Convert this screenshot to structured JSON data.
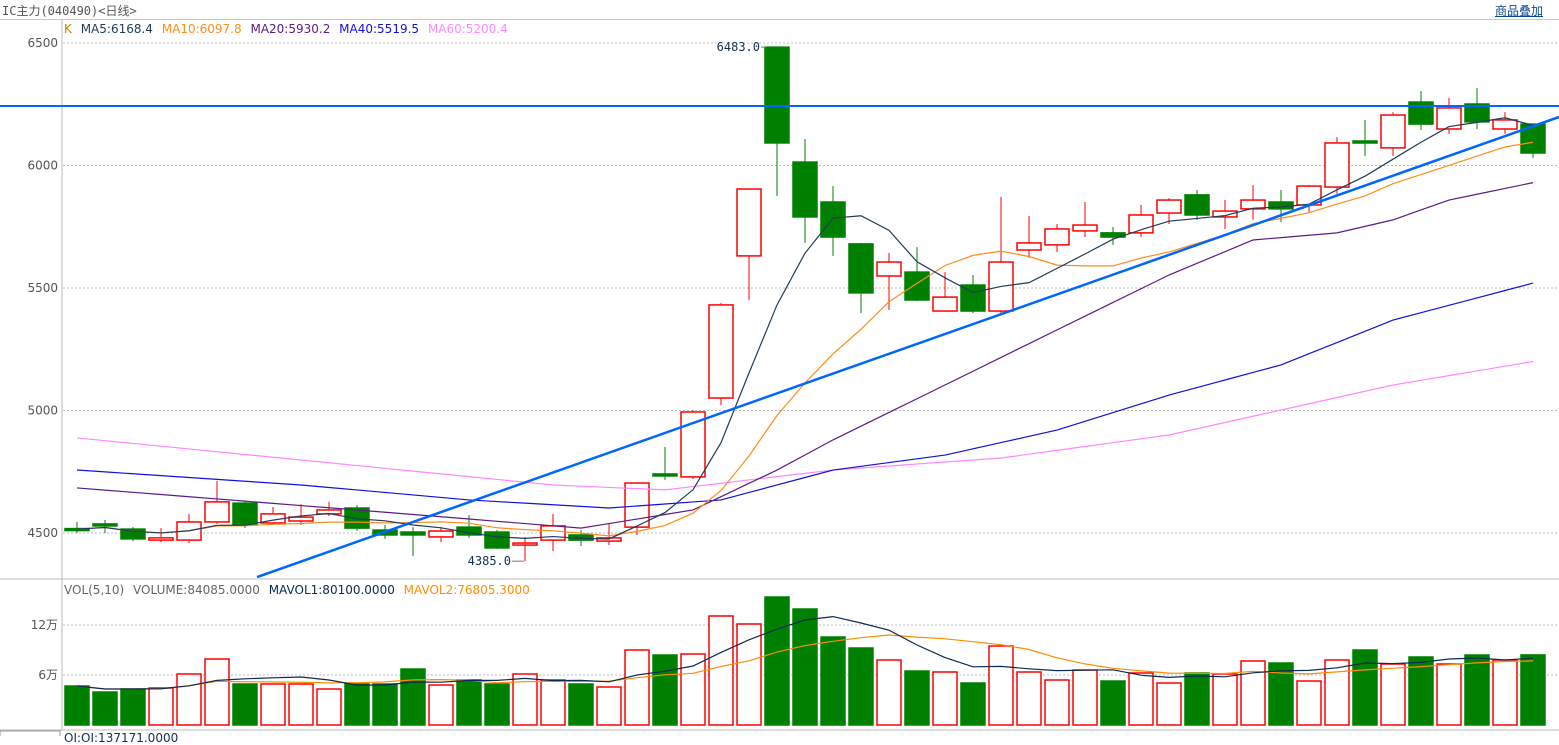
{
  "header": {
    "title": "IC主力(040490)<日线>",
    "overlay_link": "商品叠加"
  },
  "legend": {
    "k": "K",
    "ma5": "MA5:6168.4",
    "ma10": "MA10:6097.8",
    "ma20": "MA20:5930.2",
    "ma40": "MA40:5519.5",
    "ma60": "MA60:5200.4"
  },
  "vol_legend": {
    "vol": "VOL(5,10)",
    "volume": "VOLUME:84085.0000",
    "mavol1": "MAVOL1:80100.0000",
    "mavol2": "MAVOL2:76805.3000"
  },
  "bottom_legend": {
    "oi": "OI:OI:137171.0000"
  },
  "colors": {
    "up": "#ff0000",
    "down": "#008000",
    "ma5": "#1f3a5a",
    "ma10": "#ff8c1a",
    "ma20": "#5a1a8c",
    "ma40": "#1010e0",
    "ma60": "#ff88ff",
    "hline": "#0066ff",
    "mavol1": "#0a2a55",
    "mavol2": "#ff8c00"
  },
  "chart_data": {
    "type": "candlestick",
    "price_ticks": [
      "6500",
      "6000",
      "5500",
      "5000",
      "4500"
    ],
    "price_tick_values": [
      6500,
      6000,
      5500,
      5000,
      4500
    ],
    "volume_ticks": [
      "12万",
      "6万"
    ],
    "volume_tick_values": [
      120000,
      60000
    ],
    "annotations": {
      "high": "6483.0",
      "low": "4385.0",
      "high_index": 25,
      "low_index": 16,
      "high_value": 6483,
      "low_value": 4385
    },
    "ohlc": [
      [
        4518,
        4545,
        4500,
        4516
      ],
      [
        4537,
        4553,
        4500,
        4529
      ],
      [
        4516,
        4524,
        4467,
        4476
      ],
      [
        4471,
        4520,
        4463,
        4480
      ],
      [
        4471,
        4578,
        4459,
        4545
      ],
      [
        4545,
        4712,
        4537,
        4627
      ],
      [
        4622,
        4631,
        4520,
        4533
      ],
      [
        4541,
        4606,
        4533,
        4578
      ],
      [
        4549,
        4618,
        4533,
        4565
      ],
      [
        4578,
        4627,
        4569,
        4594
      ],
      [
        4602,
        4614,
        4508,
        4520
      ],
      [
        4512,
        4533,
        4476,
        4492
      ],
      [
        4504,
        4524,
        4406,
        4492
      ],
      [
        4484,
        4524,
        4463,
        4508
      ],
      [
        4524,
        4573,
        4480,
        4492
      ],
      [
        4504,
        4512,
        4435,
        4439
      ],
      [
        4451,
        4484,
        4385,
        4459
      ],
      [
        4471,
        4578,
        4427,
        4529
      ],
      [
        4492,
        4512,
        4447,
        4471
      ],
      [
        4467,
        4537,
        4451,
        4480
      ],
      [
        4524,
        4704,
        4492,
        4704
      ],
      [
        4741,
        4851,
        4716,
        4733
      ],
      [
        4729,
        5002,
        4720,
        4994
      ],
      [
        5051,
        5439,
        5022,
        5431
      ],
      [
        5631,
        5904,
        5451,
        5904
      ],
      [
        6483,
        6483,
        5876,
        6092
      ],
      [
        6014,
        6108,
        5684,
        5790
      ],
      [
        5851,
        5916,
        5631,
        5708
      ],
      [
        5680,
        5684,
        5398,
        5480
      ],
      [
        5549,
        5643,
        5410,
        5606
      ],
      [
        5565,
        5667,
        5447,
        5451
      ],
      [
        5406,
        5565,
        5406,
        5463
      ],
      [
        5512,
        5553,
        5398,
        5406
      ],
      [
        5406,
        5872,
        5390,
        5606
      ],
      [
        5655,
        5794,
        5623,
        5684
      ],
      [
        5676,
        5761,
        5647,
        5741
      ],
      [
        5733,
        5851,
        5708,
        5757
      ],
      [
        5725,
        5749,
        5676,
        5708
      ],
      [
        5725,
        5839,
        5708,
        5798
      ],
      [
        5806,
        5867,
        5761,
        5859
      ],
      [
        5880,
        5900,
        5778,
        5798
      ],
      [
        5790,
        5859,
        5741,
        5814
      ],
      [
        5823,
        5920,
        5778,
        5859
      ],
      [
        5851,
        5900,
        5769,
        5823
      ],
      [
        5839,
        5920,
        5810,
        5916
      ],
      [
        5912,
        6116,
        5884,
        6092
      ],
      [
        6100,
        6186,
        6039,
        6092
      ],
      [
        6072,
        6218,
        6039,
        6206
      ],
      [
        6259,
        6304,
        6145,
        6169
      ],
      [
        6149,
        6276,
        6129,
        6235
      ],
      [
        6251,
        6316,
        6149,
        6178
      ],
      [
        6149,
        6218,
        6129,
        6186
      ],
      [
        6169,
        6169,
        6031,
        6051
      ]
    ],
    "volume": [
      46800,
      39600,
      43200,
      44400,
      61200,
      79200,
      49200,
      49200,
      49200,
      43200,
      49200,
      49200,
      67200,
      48000,
      54000,
      49200,
      61200,
      54000,
      49200,
      45600,
      90000,
      84000,
      85200,
      130800,
      121200,
      153600,
      139200,
      105600,
      92400,
      78000,
      64800,
      63600,
      50400,
      94800,
      63600,
      54000,
      66000,
      52800,
      62400,
      50400,
      62400,
      61200,
      76800,
      74400,
      52800,
      78000,
      90000,
      73200,
      81600,
      73200,
      84000,
      78000,
      84085
    ],
    "ma20_anchors": [
      [
        0,
        4684
      ],
      [
        10,
        4594
      ],
      [
        18,
        4520
      ],
      [
        22,
        4594
      ],
      [
        25,
        4757
      ],
      [
        27,
        4880
      ],
      [
        31,
        5104
      ],
      [
        35,
        5329
      ],
      [
        39,
        5553
      ],
      [
        42,
        5696
      ],
      [
        45,
        5725
      ],
      [
        47,
        5778
      ],
      [
        49,
        5859
      ],
      [
        52,
        5930
      ]
    ],
    "ma40_anchors": [
      [
        0,
        4757
      ],
      [
        8,
        4696
      ],
      [
        14,
        4635
      ],
      [
        19,
        4602
      ],
      [
        23,
        4635
      ],
      [
        27,
        4757
      ],
      [
        31,
        4818
      ],
      [
        35,
        4920
      ],
      [
        39,
        5063
      ],
      [
        43,
        5186
      ],
      [
        47,
        5369
      ],
      [
        52,
        5520
      ]
    ],
    "ma60_anchors": [
      [
        0,
        4888
      ],
      [
        8,
        4798
      ],
      [
        17,
        4696
      ],
      [
        21,
        4676
      ],
      [
        27,
        4757
      ],
      [
        33,
        4806
      ],
      [
        39,
        4900
      ],
      [
        43,
        5002
      ],
      [
        47,
        5104
      ],
      [
        52,
        5200
      ]
    ],
    "horizontal_line": 6243,
    "trend_line": [
      [
        6.43,
        4320
      ],
      [
        52.93,
        6198
      ]
    ]
  }
}
